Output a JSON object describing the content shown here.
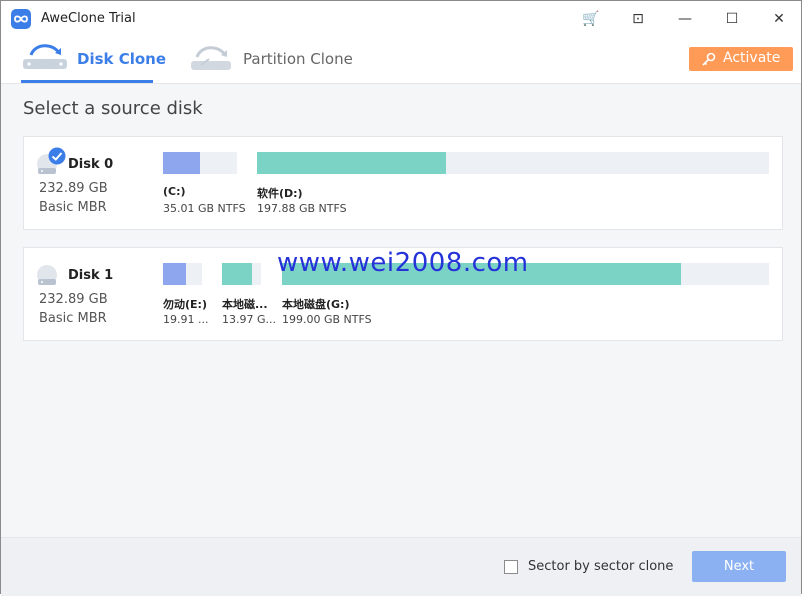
{
  "window": {
    "title": "AweClone Trial",
    "controls": {
      "cart": "🛒",
      "pin": "⊡",
      "minimize": "—",
      "maximize": "☐",
      "close": "✕"
    }
  },
  "tabs": [
    {
      "label": "Disk Clone",
      "active": true
    },
    {
      "label": "Partition Clone",
      "active": false
    }
  ],
  "activate_label": "Activate",
  "section_title": "Select a source disk",
  "disks": [
    {
      "name": "Disk 0",
      "size": "232.89 GB",
      "type": "Basic MBR",
      "selected": true,
      "partitions": [
        {
          "label": "(C:)",
          "info": "35.01 GB NTFS",
          "fill_fraction": 0.5,
          "color": "#8ea6ee"
        },
        {
          "label": "软件(D:)",
          "info": "197.88 GB NTFS",
          "fill_fraction": 0.37,
          "color": "#7bd3c6"
        }
      ]
    },
    {
      "name": "Disk 1",
      "size": "232.89 GB",
      "type": "Basic MBR",
      "selected": false,
      "partitions": [
        {
          "label": "勿动(E:)",
          "info": "19.91 ...",
          "fill_fraction": 0.6,
          "color": "#8ea6ee"
        },
        {
          "label": "本地磁...",
          "info": "13.97 G...",
          "fill_fraction": 0.77,
          "color": "#7bd3c6"
        },
        {
          "label": "本地磁盘(G:)",
          "info": "199.00 GB NTFS",
          "fill_fraction": 0.82,
          "color": "#7bd3c6"
        }
      ]
    }
  ],
  "watermark": "www.wei2008.com",
  "footer": {
    "checkbox_label": "Sector by sector clone",
    "checked": false,
    "next_label": "Next"
  },
  "colors": {
    "accent": "#3c7ee8",
    "activate": "#ff9a57",
    "next": "#8cb1f3"
  }
}
